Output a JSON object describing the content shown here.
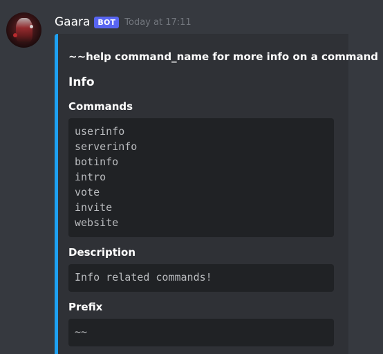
{
  "message": {
    "author": "Gaara",
    "bot_tag": "BOT",
    "timestamp": "Today at 17:11"
  },
  "embed": {
    "color": "#1ea1f2",
    "title": "~~help command_name for more info on a command",
    "section_title": "Info",
    "fields": [
      {
        "name": "Commands",
        "lines": [
          "userinfo",
          "serverinfo",
          "botinfo",
          "intro",
          "vote",
          "invite",
          "website"
        ]
      },
      {
        "name": "Description",
        "lines": [
          "Info related commands!"
        ]
      },
      {
        "name": "Prefix",
        "lines": [
          "~~"
        ]
      }
    ]
  },
  "colors": {
    "background": "#36393f",
    "embed_background": "#2f3136",
    "code_background": "#202225",
    "bot_tag": "#5865f2"
  },
  "icons": {
    "avatar": "bot-avatar-icon"
  }
}
